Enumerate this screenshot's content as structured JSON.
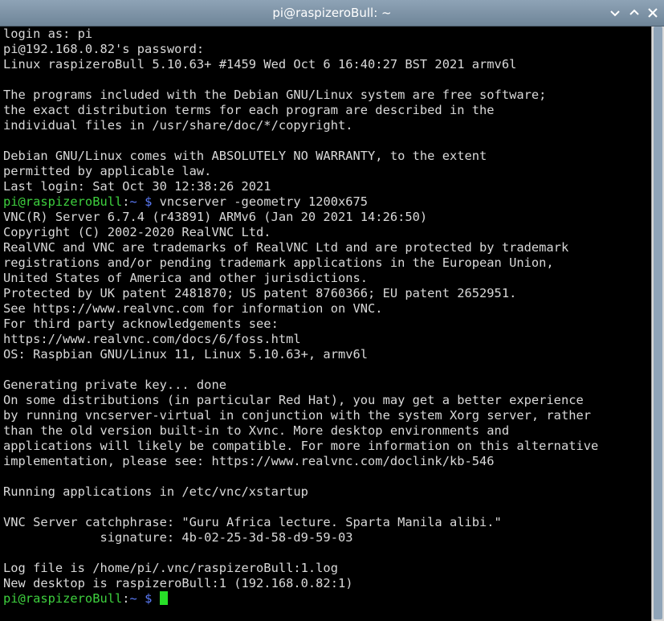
{
  "window": {
    "title": "pi@raspizeroBull: ~"
  },
  "terminal": {
    "lines": [
      "login as: pi",
      "pi@192.168.0.82's password:",
      "Linux raspizeroBull 5.10.63+ #1459 Wed Oct 6 16:40:27 BST 2021 armv6l",
      "",
      "The programs included with the Debian GNU/Linux system are free software;",
      "the exact distribution terms for each program are described in the",
      "individual files in /usr/share/doc/*/copyright.",
      "",
      "Debian GNU/Linux comes with ABSOLUTELY NO WARRANTY, to the extent",
      "permitted by applicable law.",
      "Last login: Sat Oct 30 12:38:26 2021"
    ],
    "prompt1": {
      "user": "pi@raspizeroBull",
      "sep": ":",
      "path": "~ $",
      "command": " vncserver -geometry 1200x675"
    },
    "lines2": [
      "VNC(R) Server 6.7.4 (r43891) ARMv6 (Jan 20 2021 14:26:50)",
      "Copyright (C) 2002-2020 RealVNC Ltd.",
      "RealVNC and VNC are trademarks of RealVNC Ltd and are protected by trademark",
      "registrations and/or pending trademark applications in the European Union,",
      "United States of America and other jurisdictions.",
      "Protected by UK patent 2481870; US patent 8760366; EU patent 2652951.",
      "See https://www.realvnc.com for information on VNC.",
      "For third party acknowledgements see:",
      "https://www.realvnc.com/docs/6/foss.html",
      "OS: Raspbian GNU/Linux 11, Linux 5.10.63+, armv6l",
      "",
      "Generating private key... done",
      "On some distributions (in particular Red Hat), you may get a better experience",
      "by running vncserver-virtual in conjunction with the system Xorg server, rather",
      "than the old version built-in to Xvnc. More desktop environments and",
      "applications will likely be compatible. For more information on this alternative",
      "implementation, please see: https://www.realvnc.com/doclink/kb-546",
      "",
      "Running applications in /etc/vnc/xstartup",
      "",
      "VNC Server catchphrase: \"Guru Africa lecture. Sparta Manila alibi.\"",
      "             signature: 4b-02-25-3d-58-d9-59-03",
      "",
      "Log file is /home/pi/.vnc/raspizeroBull:1.log",
      "New desktop is raspizeroBull:1 (192.168.0.82:1)"
    ],
    "prompt2": {
      "user": "pi@raspizeroBull",
      "sep": ":",
      "path": "~ $",
      "command": " "
    }
  },
  "colors": {
    "prompt_user": "#3ed13e",
    "prompt_path": "#5c7cfa",
    "cursor": "#28e028"
  },
  "icons": [
    "minimize-icon",
    "maximize-icon",
    "close-icon"
  ]
}
